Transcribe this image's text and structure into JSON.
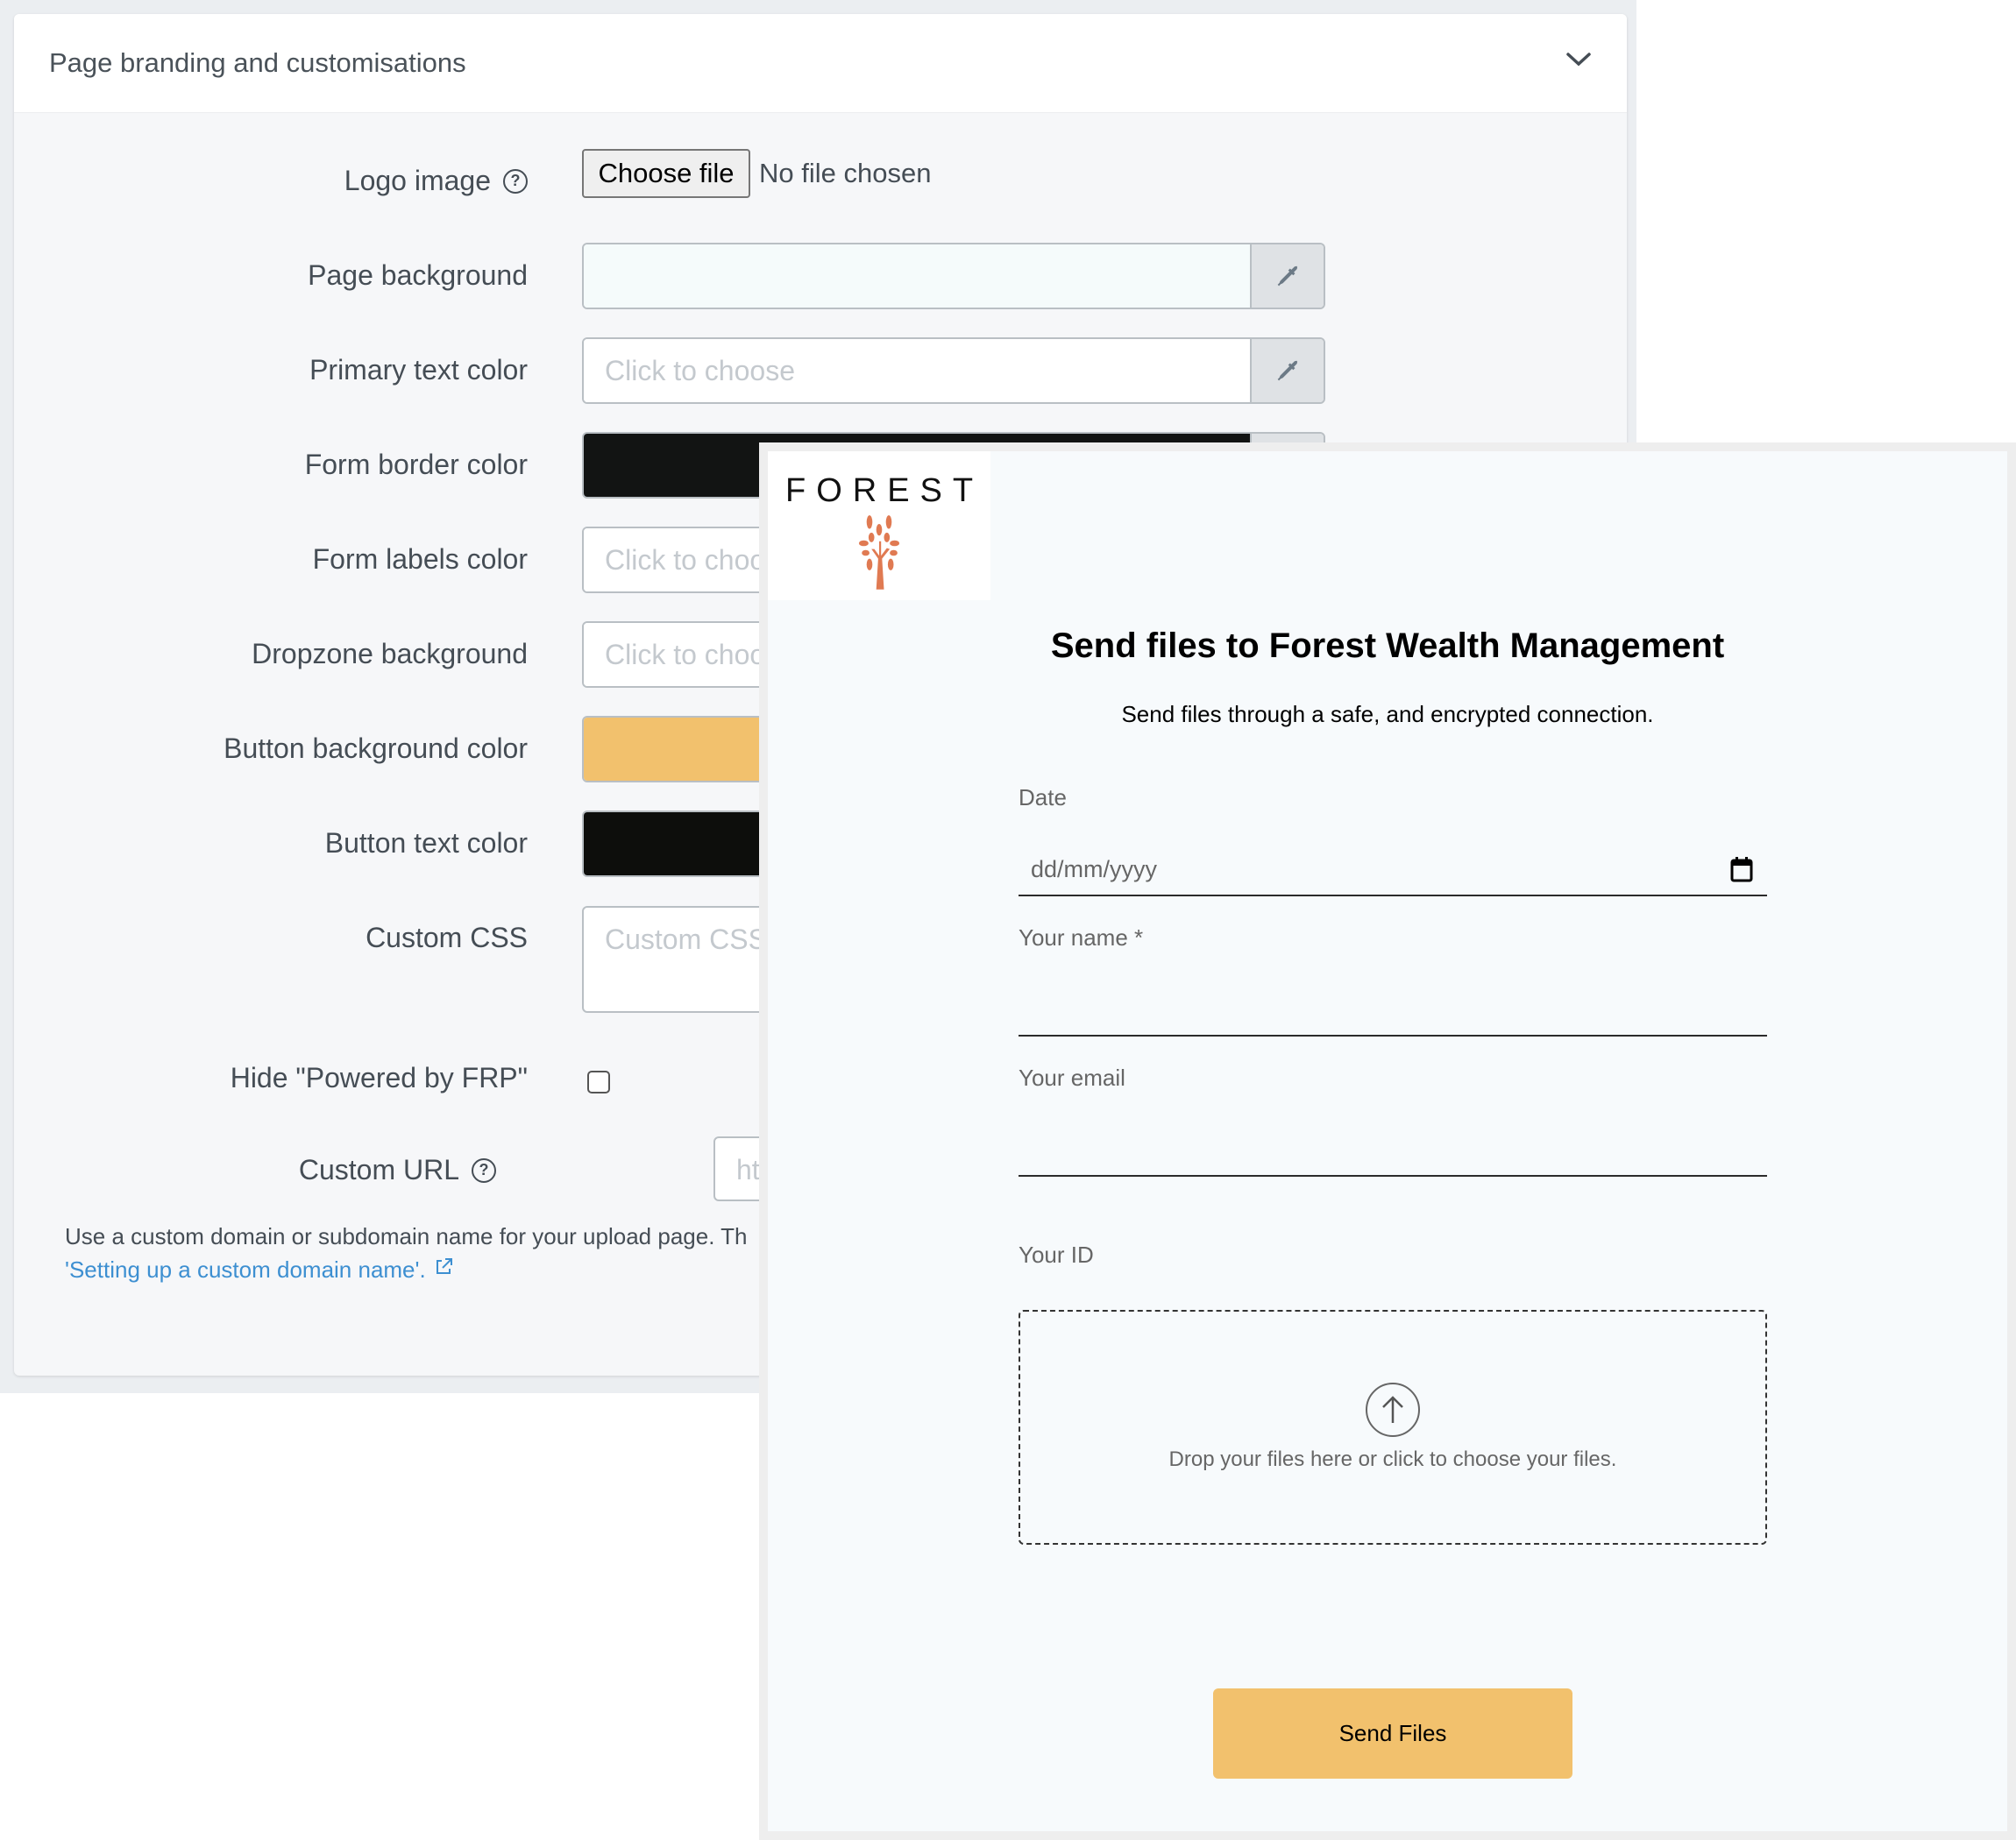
{
  "settings": {
    "section_title": "Page branding and customisations",
    "logo": {
      "label": "Logo image",
      "button": "Choose file",
      "status": "No file chosen"
    },
    "rows": [
      {
        "label": "Page background",
        "value": "",
        "placeholder": "",
        "swatch": "#f5fbfb"
      },
      {
        "label": "Primary text color",
        "value": "",
        "placeholder": "Click to choose",
        "swatch": "#ffffff"
      },
      {
        "label": "Form border color",
        "value": "",
        "placeholder": "",
        "swatch": "#121413"
      },
      {
        "label": "Form labels color",
        "value": "",
        "placeholder": "Click to choose",
        "swatch": "#ffffff"
      },
      {
        "label": "Dropzone background",
        "value": "",
        "placeholder": "Click to choose",
        "swatch": "#ffffff"
      },
      {
        "label": "Button background color",
        "value": "",
        "placeholder": "",
        "swatch": "#f2c16d"
      },
      {
        "label": "Button text color",
        "value": "",
        "placeholder": "",
        "swatch": "#0d0e0c"
      }
    ],
    "custom_css": {
      "label": "Custom CSS",
      "placeholder": "Custom CSS"
    },
    "hide_powered": {
      "label": "Hide \"Powered by FRP\"",
      "checked": false
    },
    "custom_url": {
      "label": "Custom URL",
      "placeholder": "https://"
    },
    "help_text": "Use a custom domain or subdomain name for your upload page. Th",
    "help_link": "'Setting up a custom domain name'."
  },
  "preview": {
    "logo_word": "FOREST",
    "logo_color": "#e07a52",
    "title": "Send files to Forest Wealth Management",
    "subtitle": "Send files through a safe, and encrypted connection.",
    "fields": {
      "date_label": "Date",
      "date_placeholder": "dd/mm/yyyy",
      "name_label": "Your name *",
      "email_label": "Your email",
      "id_label": "Your ID"
    },
    "dropzone_text": "Drop your files here or click to choose your files.",
    "button_label": "Send Files",
    "button_color": "#f2c16d"
  }
}
